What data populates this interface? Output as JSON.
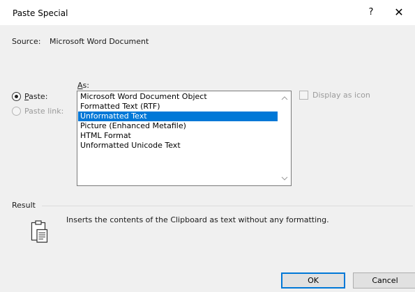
{
  "window": {
    "title": "Paste Special",
    "help_label": "?",
    "close_label": "✕"
  },
  "source": {
    "label": "Source:",
    "value": "Microsoft Word Document"
  },
  "as_label": {
    "underlined": "A",
    "rest": "s:"
  },
  "paste_options": {
    "paste": {
      "underlined": "P",
      "rest": "aste:",
      "checked": true,
      "enabled": true
    },
    "paste_link": {
      "label": "Paste link:",
      "checked": false,
      "enabled": false
    }
  },
  "formats": [
    "Microsoft Word Document Object",
    "Formatted Text (RTF)",
    "Unformatted Text",
    "Picture (Enhanced Metafile)",
    "HTML Format",
    "Unformatted Unicode Text"
  ],
  "selected_index": 2,
  "display_as_icon": {
    "label": "Display as icon",
    "checked": false,
    "enabled": false
  },
  "result": {
    "label": "Result",
    "text": "Inserts the contents of the Clipboard as text without any formatting.",
    "icon": "clipboard-document-icon"
  },
  "buttons": {
    "ok": "OK",
    "cancel": "Cancel"
  },
  "colors": {
    "selection": "#0078d7",
    "dialog_bg": "#f0f0f0",
    "default_button_border": "#0078d7"
  }
}
